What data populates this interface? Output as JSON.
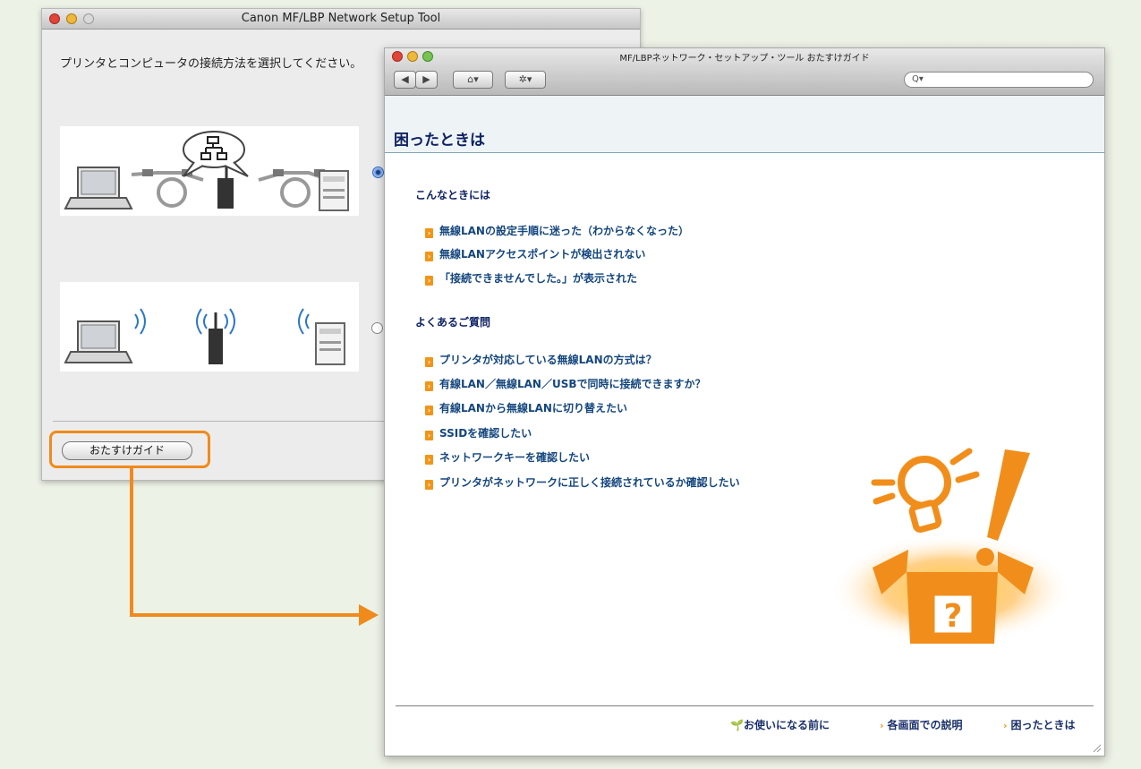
{
  "setup_window": {
    "title": "Canon MF/LBP Network Setup Tool",
    "instruction": "プリンタとコンピュータの接続方法を選択してください。",
    "options": [
      {
        "name": "wired-lan",
        "selected": true
      },
      {
        "name": "wireless-lan",
        "selected": false
      }
    ],
    "guide_button_label": "おたすけガイド"
  },
  "help_window": {
    "title": "MF/LBPネットワーク・セットアップ・ツール おたすけガイド",
    "toolbar": {
      "back_icon": "back-arrow-icon",
      "forward_icon": "forward-arrow-icon",
      "home_icon": "home-icon",
      "gear_icon": "gear-icon",
      "search_icon": "search-icon"
    },
    "page_title": "困ったときは",
    "section1": {
      "title": "こんなときには",
      "links": [
        "無線LANの設定手順に迷った（わからなくなった）",
        "無線LANアクセスポイントが検出されない",
        "「接続できませんでした。」が表示された"
      ]
    },
    "section2": {
      "title": "よくあるご質問",
      "links": [
        "プリンタが対応している無線LANの方式は？",
        "有線LAN／無線LAN／USBで同時に接続できますか？",
        "有線LANから無線LANに切り替えたい",
        "SSIDを確認したい",
        "ネットワークキーを確認したい",
        "プリンタがネットワークに正しく接続されているか確認したい"
      ]
    },
    "footer": {
      "before_use": "お使いになる前に",
      "screen_desc": "各画面での説明",
      "trouble": "困ったときは"
    }
  },
  "colors": {
    "accent_orange": "#f08a1c",
    "link_blue": "#14467e",
    "heading_navy": "#0f2264",
    "page_bg": "#edf2e6"
  }
}
